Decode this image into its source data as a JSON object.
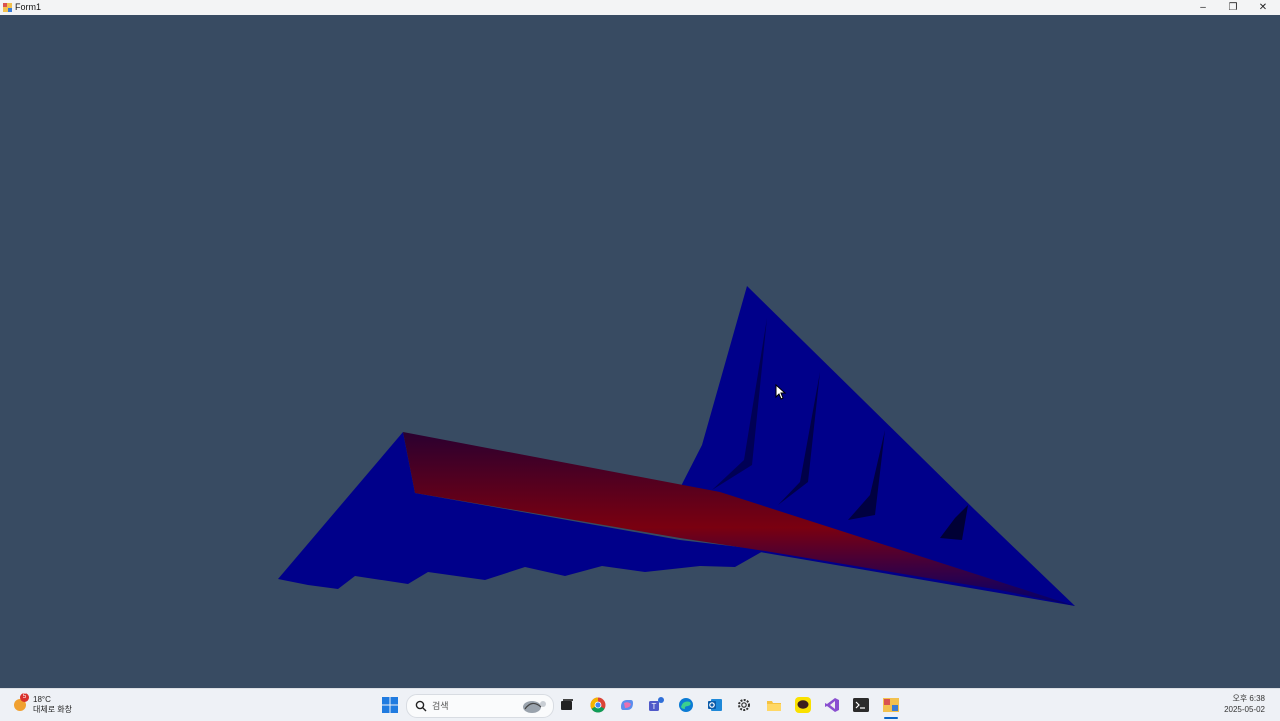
{
  "window": {
    "title": "Form1",
    "minimize_label": "–",
    "restore_label": "❐",
    "close_label": "✕"
  },
  "taskbar": {
    "weather": {
      "temperature": "18°C",
      "description": "대체로 화창",
      "badge": "5"
    },
    "search": {
      "placeholder": "검색"
    },
    "pinned_icons": [
      "windows-start-icon",
      "search-icon",
      "task-view-icon",
      "chrome-icon",
      "copilot-icon",
      "teams-icon",
      "edge-icon",
      "outlook-icon",
      "settings-icon",
      "file-explorer-icon",
      "kakaotalk-icon",
      "visual-studio-icon",
      "terminal-icon",
      "form1-app-icon"
    ],
    "clock": {
      "time": "오후 6:38",
      "date": "2025-05-02"
    }
  },
  "colors": {
    "viewport_background": "#384b62",
    "surface_blue": "#00008a",
    "surface_red": "#8b0000",
    "taskbar_background": "#eef1f6"
  }
}
